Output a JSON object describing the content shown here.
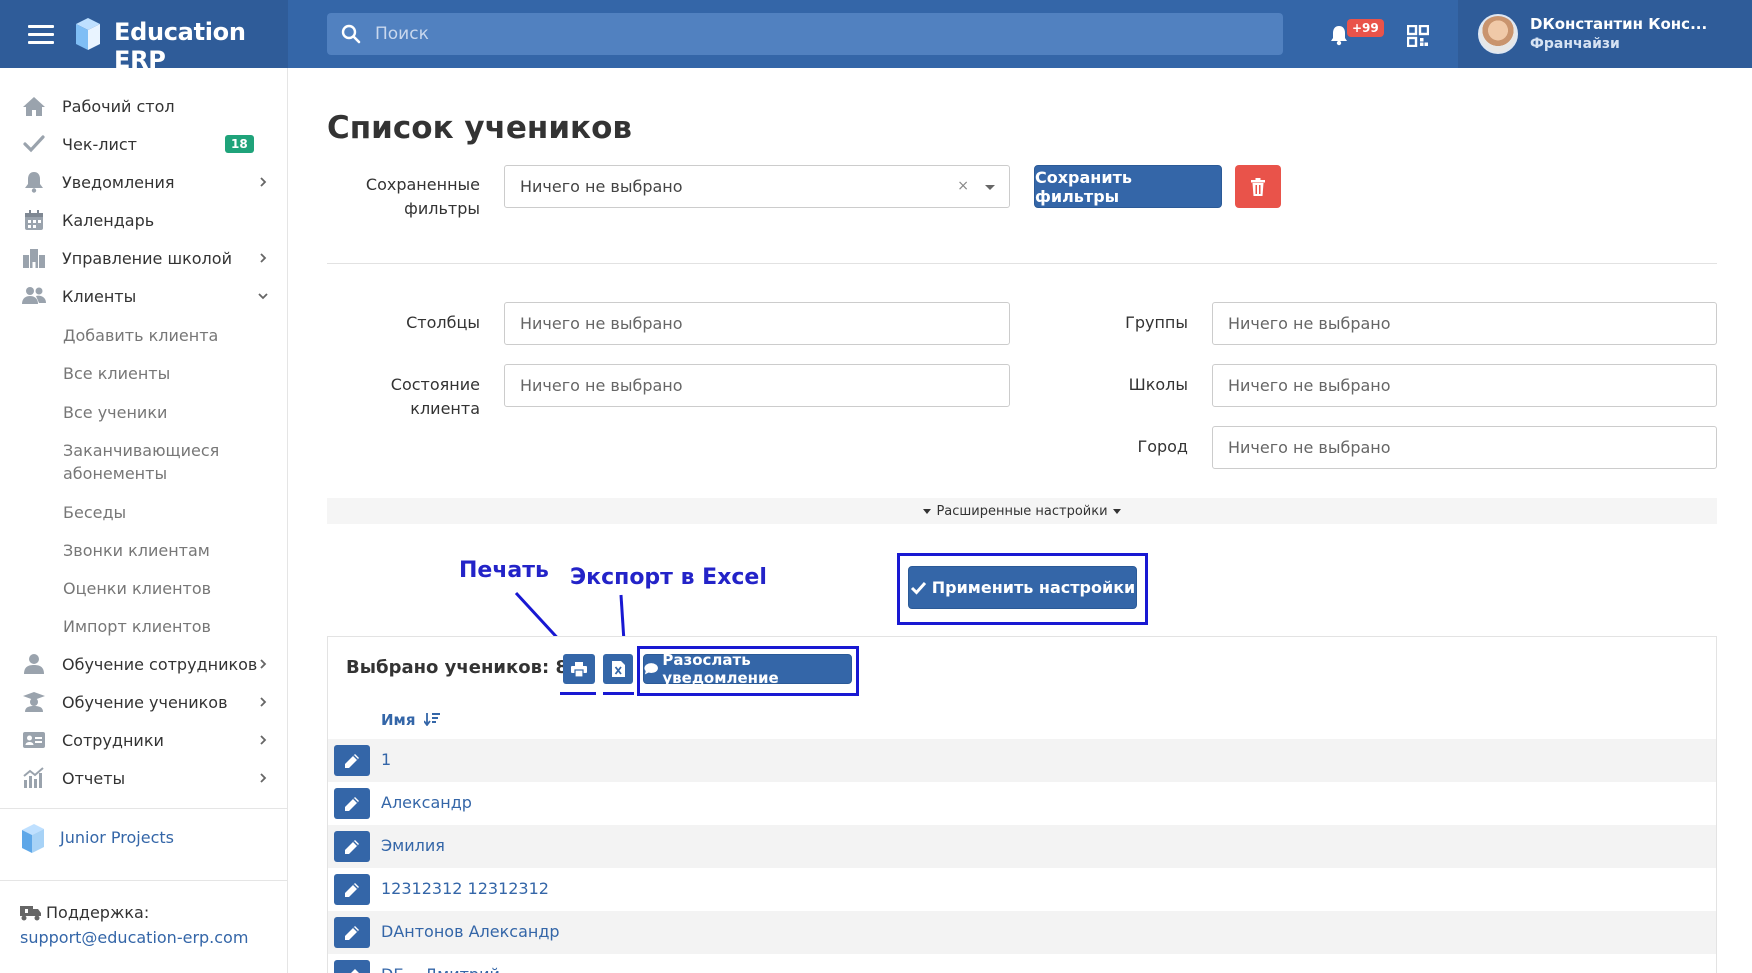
{
  "topbar": {
    "brand": "Education ERP",
    "search_placeholder": "Поиск",
    "notif_badge": "+99",
    "user_name": "DКонстантин Конс...",
    "user_role": "Франчайзи"
  },
  "sidebar": {
    "items": [
      {
        "label": "Рабочий стол",
        "icon": "home-icon"
      },
      {
        "label": "Чек-лист",
        "icon": "check-icon",
        "badge": "18"
      },
      {
        "label": "Уведомления",
        "icon": "bell-icon"
      },
      {
        "label": "Календарь",
        "icon": "calendar-icon"
      },
      {
        "label": "Управление школой",
        "icon": "school-icon"
      },
      {
        "label": "Клиенты",
        "icon": "users-icon"
      }
    ],
    "sub_items": [
      "Добавить клиента",
      "Все клиенты",
      "Все ученики",
      "Заканчивающиеся абонементы",
      "Беседы",
      "Звонки клиентам",
      "Оценки клиентов",
      "Импорт клиентов"
    ],
    "items2": [
      {
        "label": "Обучение сотрудников",
        "icon": "staff-training-icon"
      },
      {
        "label": "Обучение учеников",
        "icon": "graduation-icon"
      },
      {
        "label": "Сотрудники",
        "icon": "id-card-icon"
      },
      {
        "label": "Отчеты",
        "icon": "chart-icon"
      }
    ],
    "junior": "Junior Projects",
    "support_label": "Поддержка:",
    "support_email": "support@education-erp.com"
  },
  "main": {
    "title": "Список учеников",
    "saved_filters_label": "Сохраненные фильтры",
    "saved_filters_value": "Ничего не выбрано",
    "save_filters_button": "Сохранить фильтры",
    "columns_label": "Столбцы",
    "client_state_label": "Состояние клиента",
    "groups_label": "Группы",
    "schools_label": "Школы",
    "city_label": "Город",
    "placeholder": "Ничего не выбрано",
    "advanced": "Расширенные настройки",
    "apply_button": "Применить настройки",
    "selected_count": "Выбрано учеников: 89",
    "send_notification": "Разослать уведомление",
    "name_header": "Имя"
  },
  "annotations": {
    "print": "Печать",
    "export": "Экспорт в Excel"
  },
  "students": [
    "1",
    "Александр",
    "Эмилия",
    "12312312 12312312",
    "DАнтонов Александр",
    "DБ... Дмитрий"
  ]
}
